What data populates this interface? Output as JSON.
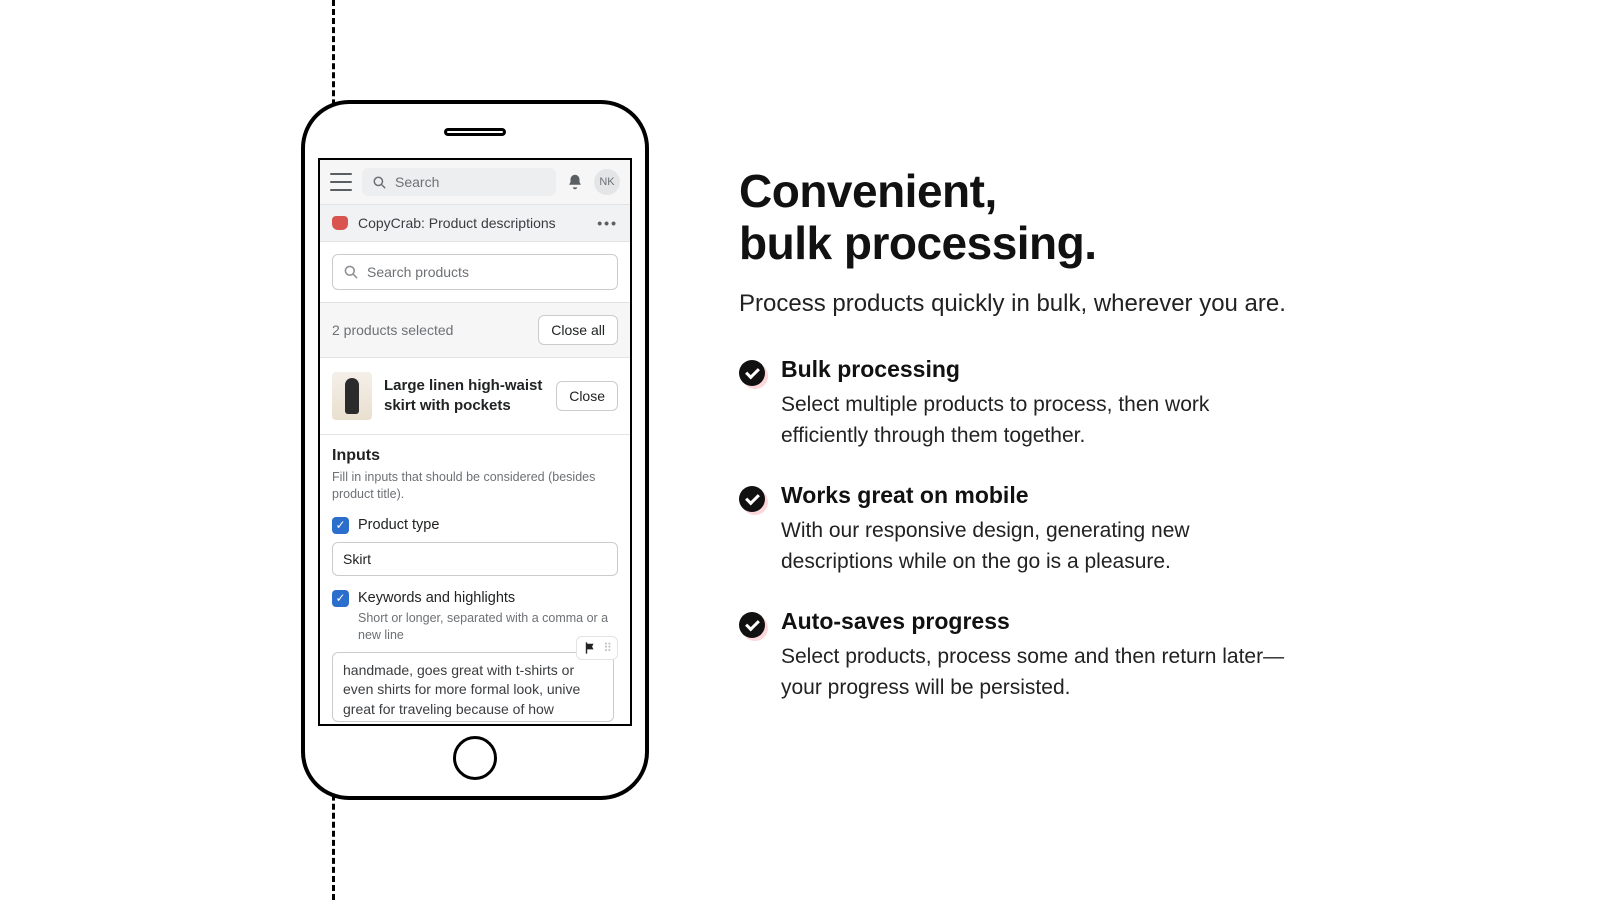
{
  "marketing": {
    "title_line1": "Convenient,",
    "title_line2": "bulk processing.",
    "lead": "Process products quickly in bulk, wherever you are.",
    "features": [
      {
        "title": "Bulk processing",
        "body": "Select multiple products to process, then work efficiently through them together."
      },
      {
        "title": "Works great on mobile",
        "body": "With our responsive design, generating new descriptions while on the go is a pleasure."
      },
      {
        "title": "Auto-saves progress",
        "body": "Select products, process some and then return later—your progress will be persisted."
      }
    ]
  },
  "app": {
    "search_placeholder": "Search",
    "avatar_initials": "NK",
    "app_title": "CopyCrab: Product descriptions",
    "search_products_placeholder": "Search products",
    "selected_text": "2 products selected",
    "close_all_label": "Close all",
    "product": {
      "title": "Large linen high-waist skirt with pockets",
      "close_label": "Close"
    },
    "inputs": {
      "heading": "Inputs",
      "hint": "Fill in inputs that should be considered (besides product title).",
      "product_type": {
        "label": "Product type",
        "value": "Skirt",
        "checked": true
      },
      "keywords": {
        "label": "Keywords and highlights",
        "hint": "Short or longer, separated with a comma or a new line",
        "value": "handmade, goes great with t-shirts or even shirts for more formal look, unive great for traveling because of how",
        "checked": true
      }
    }
  }
}
